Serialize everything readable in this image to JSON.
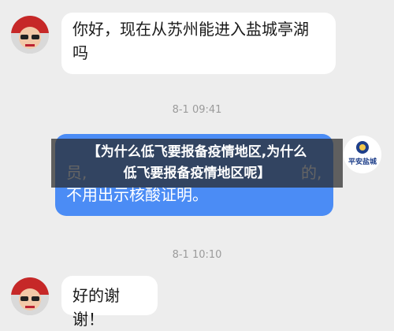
{
  "messages": [
    {
      "text_line1": "你好，现在从苏州能进入盐城亭湖",
      "text_line2": "吗"
    },
    {
      "timestamp": "8-1 09:41"
    },
    {
      "visible_line1": "员,",
      "visible_line1_right": "的,",
      "visible_line2": "不用出示核酸证明。"
    },
    {
      "timestamp": "8-1 10:10"
    },
    {
      "text": "好的谢谢！"
    }
  ],
  "avatar_logo_text": "平安盐城",
  "overlay": {
    "line1": "【为什么低飞要报备疫情地区,为什么",
    "line2": "低飞要报备疫情地区呢】"
  },
  "colors": {
    "background": "#ededed",
    "self_bubble": "#4b8cf5",
    "other_bubble": "#ffffff",
    "overlay": "#282828"
  }
}
